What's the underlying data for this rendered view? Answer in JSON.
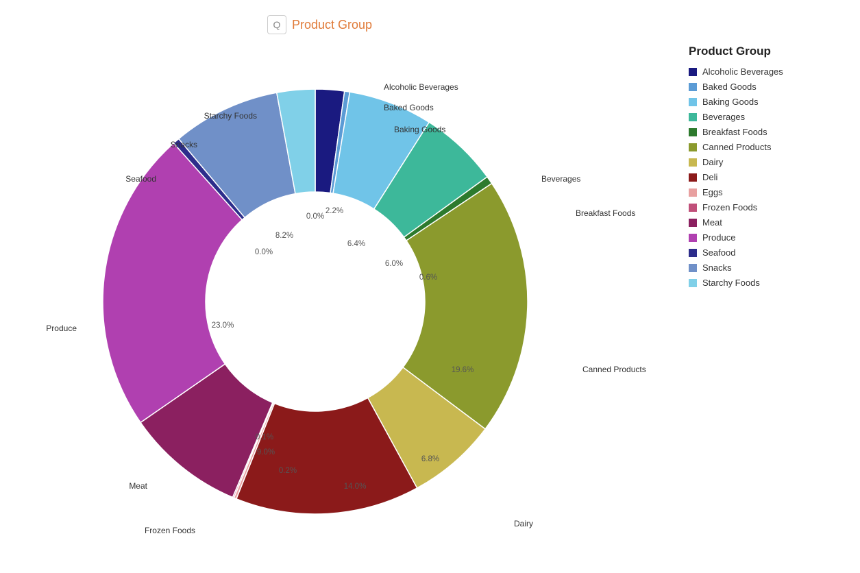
{
  "title": "Product Group",
  "icon": "🔍",
  "legend": {
    "title": "Product Group",
    "items": [
      {
        "label": "Alcoholic Beverages",
        "color": "#1a1a80"
      },
      {
        "label": "Baked Goods",
        "color": "#5b9bd5"
      },
      {
        "label": "Baking Goods",
        "color": "#70c4e8"
      },
      {
        "label": "Beverages",
        "color": "#3db89a"
      },
      {
        "label": "Breakfast Foods",
        "color": "#2d7a2d"
      },
      {
        "label": "Canned Products",
        "color": "#8b9a2d"
      },
      {
        "label": "Dairy",
        "color": "#c8b850"
      },
      {
        "label": "Deli",
        "color": "#8b1a1a"
      },
      {
        "label": "Eggs",
        "color": "#e8a0a0"
      },
      {
        "label": "Frozen Foods",
        "color": "#c0507a"
      },
      {
        "label": "Meat",
        "color": "#8b2060"
      },
      {
        "label": "Produce",
        "color": "#b040b0"
      },
      {
        "label": "Seafood",
        "color": "#2d2d8b"
      },
      {
        "label": "Snacks",
        "color": "#7090c8"
      },
      {
        "label": "Starchy Foods",
        "color": "#80d0e8"
      }
    ]
  },
  "segments": [
    {
      "label": "Alcoholic Beverages",
      "pct": "2.2%",
      "value": 2.2,
      "color": "#1a1a80"
    },
    {
      "label": "Baked Goods",
      "pct": "0.0%",
      "value": 0.4,
      "color": "#5b9bd5"
    },
    {
      "label": "Baking Goods",
      "pct": "6.4%",
      "value": 6.4,
      "color": "#70c4e8"
    },
    {
      "label": "Beverages",
      "pct": "6.0%",
      "value": 6.0,
      "color": "#3db89a"
    },
    {
      "label": "Breakfast Foods",
      "pct": "0.6%",
      "value": 0.6,
      "color": "#2d7a2d"
    },
    {
      "label": "Canned Products",
      "pct": "19.6%",
      "value": 19.6,
      "color": "#8b9a2d"
    },
    {
      "label": "Dairy",
      "pct": "6.8%",
      "value": 6.8,
      "color": "#c8b850"
    },
    {
      "label": "Deli",
      "pct": "14.0%",
      "value": 14.0,
      "color": "#8b1a1a"
    },
    {
      "label": "Eggs",
      "pct": "0.2%",
      "value": 0.2,
      "color": "#e8a0a0"
    },
    {
      "label": "Frozen Foods",
      "pct": "0.1%",
      "value": 0.1,
      "color": "#c0507a"
    },
    {
      "label": "Meat",
      "pct": "9.0%",
      "value": 9.0,
      "color": "#8b2060"
    },
    {
      "label": "Produce",
      "pct": "23.0%",
      "value": 23.0,
      "color": "#b040b0"
    },
    {
      "label": "Seafood",
      "pct": "0.0%",
      "value": 0.5,
      "color": "#2d2d8b"
    },
    {
      "label": "Snacks",
      "pct": "8.2%",
      "value": 8.2,
      "color": "#7090c8"
    },
    {
      "label": "Starchy Foods",
      "pct": "0.0%",
      "value": 2.9,
      "color": "#80d0e8"
    }
  ]
}
